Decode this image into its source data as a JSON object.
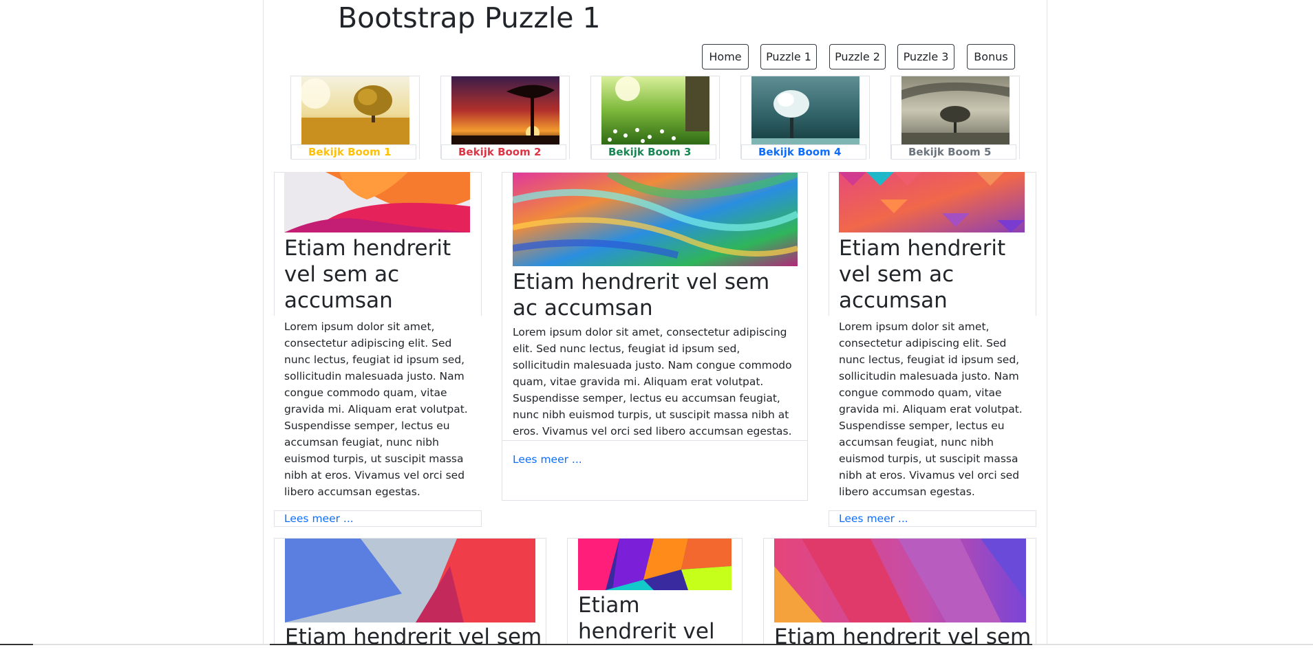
{
  "page": {
    "title": "Bootstrap Puzzle 1"
  },
  "nav": {
    "items": [
      {
        "label": "Home"
      },
      {
        "label": "Puzzle 1"
      },
      {
        "label": "Puzzle 2"
      },
      {
        "label": "Puzzle 3"
      },
      {
        "label": "Bonus"
      }
    ]
  },
  "trees": [
    {
      "label": "Bekijk Boom 1",
      "color": "#ffc107"
    },
    {
      "label": "Bekijk Boom 2",
      "color": "#dc3545"
    },
    {
      "label": "Bekijk Boom 3",
      "color": "#198754"
    },
    {
      "label": "Bekijk Boom 4",
      "color": "#0d6efd"
    },
    {
      "label": "Bekijk Boom 5",
      "color": "#6c757d"
    }
  ],
  "cards": [
    {
      "heading": "Etiam hendrerit vel sem ac accumsan",
      "body": "Lorem ipsum dolor sit amet, consectetur adipiscing elit. Sed nunc lectus, feugiat id ipsum sed, sollicitudin malesuada justo. Nam congue commodo quam, vitae gravida mi. Aliquam erat volutpat. Suspendisse semper, lectus eu accumsan feugiat, nunc nibh euismod turpis, ut suscipit massa nibh at eros. Vivamus vel orci sed libero accumsan egestas.",
      "link": "Lees meer ..."
    },
    {
      "heading": "Etiam hendrerit vel sem ac accumsan",
      "body": "Lorem ipsum dolor sit amet, consectetur adipiscing elit. Sed nunc lectus, feugiat id ipsum sed, sollicitudin malesuada justo. Nam congue commodo quam, vitae gravida mi. Aliquam erat volutpat. Suspendisse semper, lectus eu accumsan feugiat, nunc nibh euismod turpis, ut suscipit massa nibh at eros. Vivamus vel orci sed libero accumsan egestas.",
      "link": "Lees meer ..."
    },
    {
      "heading": "Etiam hendrerit vel sem ac accumsan",
      "body": "Lorem ipsum dolor sit amet, consectetur adipiscing elit. Sed nunc lectus, feugiat id ipsum sed, sollicitudin malesuada justo. Nam congue commodo quam, vitae gravida mi. Aliquam erat volutpat. Suspendisse semper, lectus eu accumsan feugiat, nunc nibh euismod turpis, ut suscipit massa nibh at eros. Vivamus vel orci sed libero accumsan egestas.",
      "link": "Lees meer ..."
    }
  ],
  "cards_row2": [
    {
      "heading": "Etiam hendrerit vel sem"
    },
    {
      "heading": "Etiam hendrerit vel"
    },
    {
      "heading": "Etiam hendrerit vel sem"
    }
  ]
}
